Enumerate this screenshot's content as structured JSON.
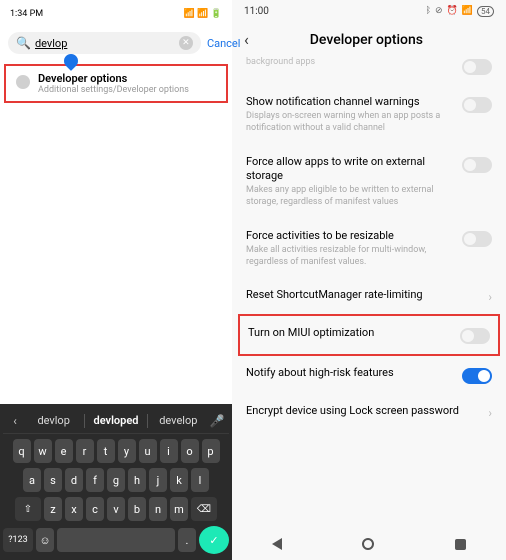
{
  "left": {
    "status_time": "1:34 PM",
    "status_left_icons": "⋮ ✝ ☁ ⋯",
    "status_right_icons": "📶 📶 ⚡ 🔋",
    "search_value": "devlop",
    "clear_icon": "✕",
    "cancel": "Cancel",
    "result": {
      "title": "Developer options",
      "subtitle": "Additional settings/Developer options"
    },
    "suggestions": [
      "devlop",
      "devloped",
      "develop"
    ],
    "kb_rows": {
      "r1": [
        "q",
        "w",
        "e",
        "r",
        "t",
        "y",
        "u",
        "i",
        "o",
        "p"
      ],
      "r2": [
        "a",
        "s",
        "d",
        "f",
        "g",
        "h",
        "j",
        "k",
        "l"
      ],
      "r3_shift": "⇧",
      "r3": [
        "z",
        "x",
        "c",
        "v",
        "b",
        "n",
        "m"
      ],
      "r3_back": "⌫",
      "r4_sym": "?123",
      "r4_emoji": "☺",
      "r4_dot": ".",
      "r4_enter": "✓"
    }
  },
  "right": {
    "status_time": "11:00",
    "status_icons": "✽ ⊘ ⊗ 📶",
    "battery": "54",
    "header_title": "Developer options",
    "items": [
      {
        "title_trunc": "background apps",
        "desc": "",
        "toggle": "off",
        "truncated_top": true
      },
      {
        "title": "Show notification channel warnings",
        "desc": "Displays on-screen warning when an app posts a notification without a valid channel",
        "toggle": "off"
      },
      {
        "title": "Force allow apps to write on external storage",
        "desc": "Makes any app eligible to be written to external storage, regardless of manifest values",
        "toggle": "off"
      },
      {
        "title": "Force activities to be resizable",
        "desc": "Make all activities resizable for multi-window, regardless of manifest values.",
        "toggle": "off"
      },
      {
        "title": "Reset ShortcutManager rate-limiting",
        "desc": "",
        "chevron": true
      },
      {
        "title": "Turn on MIUI optimization",
        "desc": "",
        "toggle": "off",
        "highlight": true
      },
      {
        "title": "Notify about high-risk features",
        "desc": "",
        "toggle": "on"
      },
      {
        "title": "Encrypt device using Lock screen password",
        "desc": "",
        "chevron": true
      }
    ]
  }
}
